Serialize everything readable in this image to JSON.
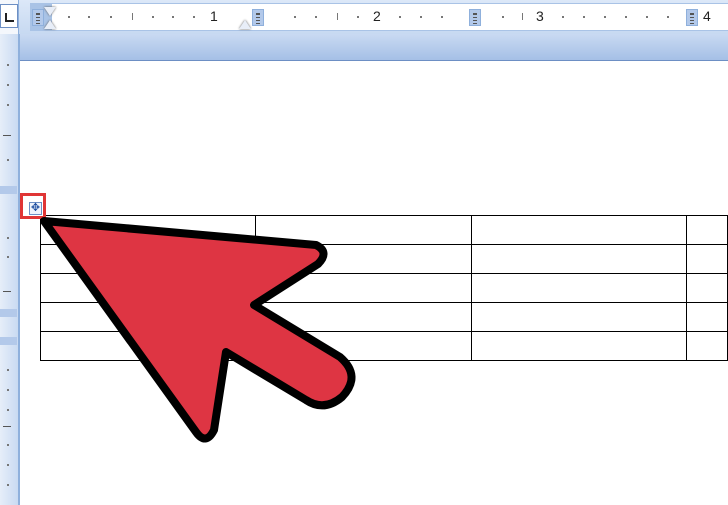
{
  "horizontal_ruler": {
    "numbers": [
      "1",
      "2",
      "3",
      "4"
    ]
  },
  "tab_selector": {
    "icon": "left-tab-icon"
  },
  "table": {
    "rows": 5,
    "columns": 4
  },
  "table_move_handle": {
    "icon": "four-way-move-icon",
    "highlight_color": "#e03535"
  },
  "annotation_arrow": {
    "fill_color": "#de3543",
    "outline_color": "#000000"
  }
}
